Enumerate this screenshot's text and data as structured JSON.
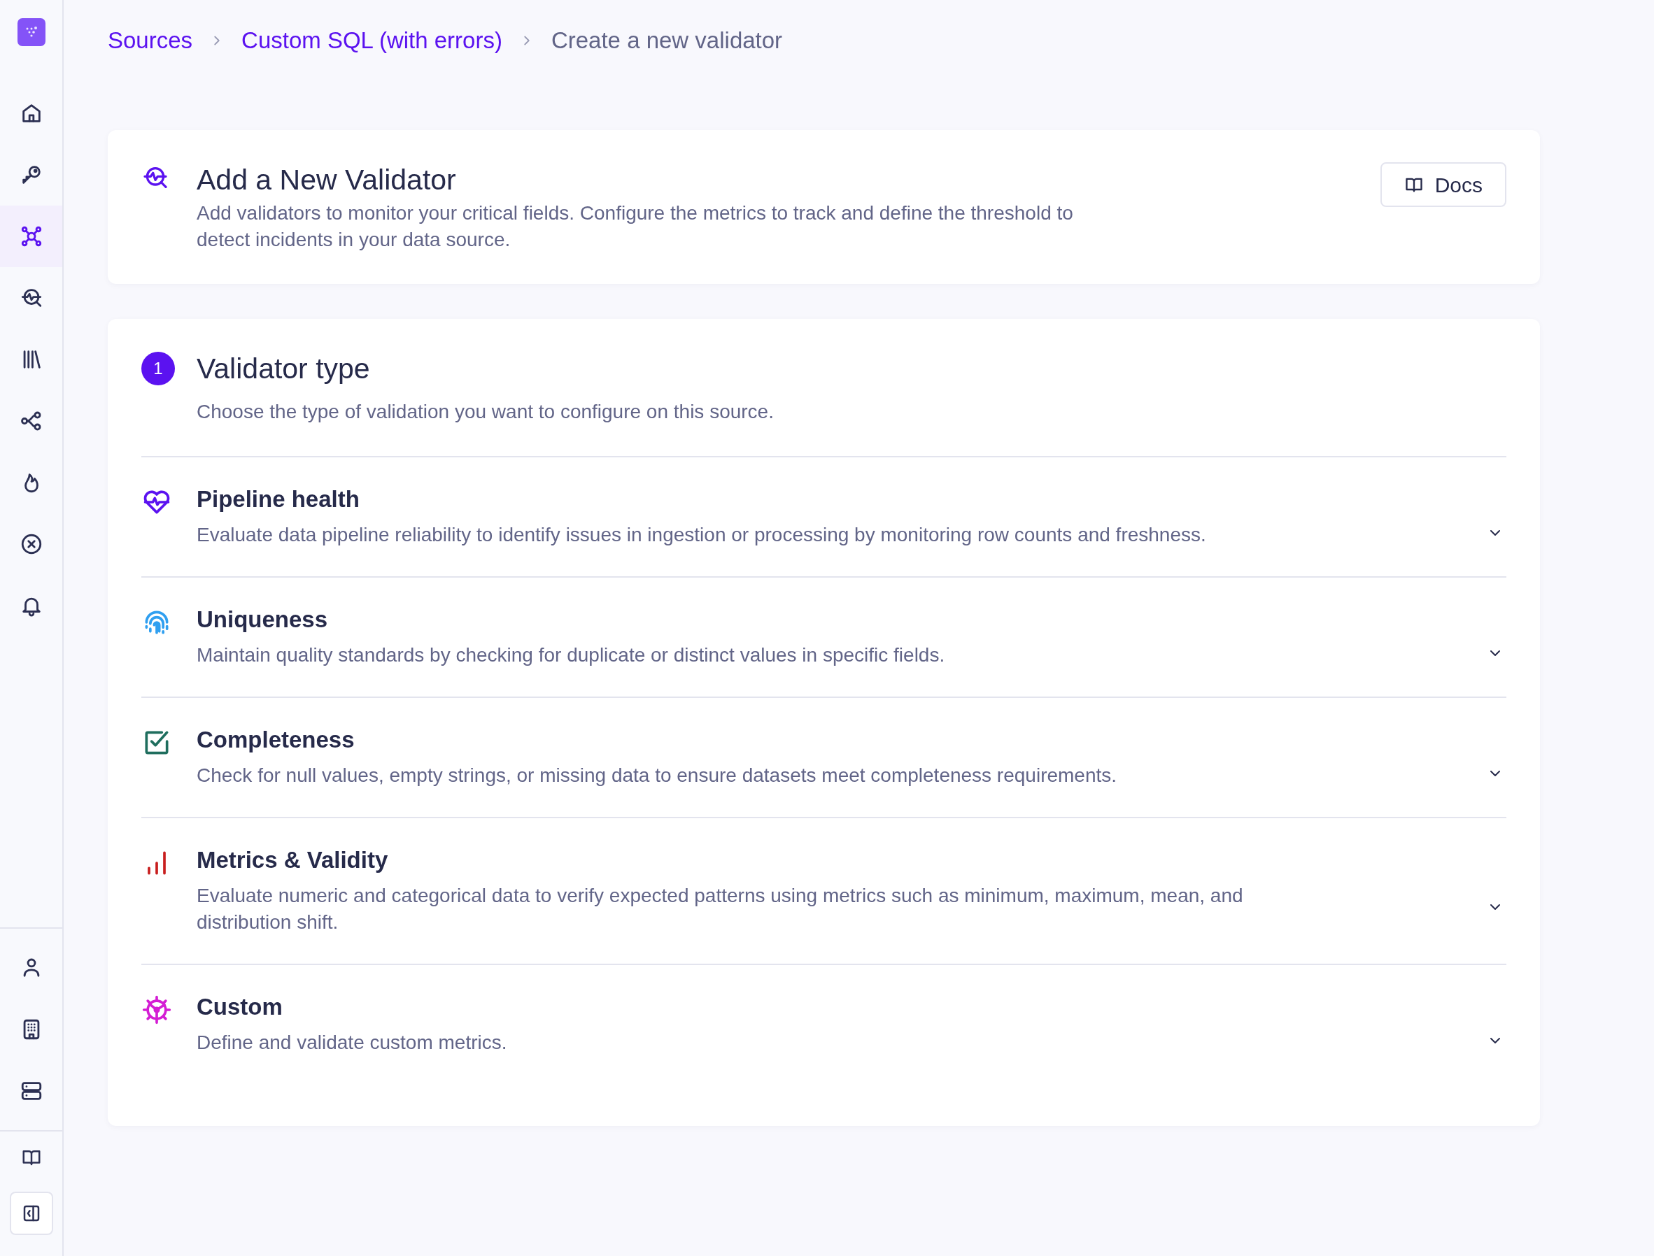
{
  "sidebar": {
    "items": [
      {
        "kind": "home",
        "selected": false
      },
      {
        "kind": "key",
        "selected": false
      },
      {
        "kind": "nodes",
        "selected": true
      },
      {
        "kind": "monitor",
        "selected": false
      },
      {
        "kind": "library",
        "selected": false
      },
      {
        "kind": "share",
        "selected": false
      },
      {
        "kind": "flame",
        "selected": false
      },
      {
        "kind": "cancel",
        "selected": false
      },
      {
        "kind": "bell",
        "selected": false
      }
    ],
    "bottom_items": [
      {
        "kind": "user",
        "selected": false
      },
      {
        "kind": "building",
        "selected": false
      },
      {
        "kind": "server",
        "selected": false
      }
    ],
    "footer_items": [
      {
        "kind": "book"
      },
      {
        "kind": "collapse"
      }
    ]
  },
  "breadcrumb": [
    {
      "label": "Sources",
      "current": false
    },
    {
      "label": "Custom SQL (with errors)",
      "current": false
    },
    {
      "label": "Create a new validator",
      "current": true
    }
  ],
  "header": {
    "title": "Add a New Validator",
    "description": "Add validators to monitor your critical fields. Configure the metrics to track and define the threshold to detect incidents in your data source.",
    "docs_button": "Docs"
  },
  "step": {
    "number": "1",
    "title": "Validator type",
    "description": "Choose the type of validation you want to configure on this source."
  },
  "validator_types": [
    {
      "kind": "pipeline",
      "title": "Pipeline health",
      "description": "Evaluate data pipeline reliability to identify issues in ingestion or processing by monitoring row counts and freshness.",
      "expanded": false
    },
    {
      "kind": "uniqueness",
      "title": "Uniqueness",
      "description": "Maintain quality standards by checking for duplicate or distinct values in specific fields.",
      "expanded": false
    },
    {
      "kind": "completeness",
      "title": "Completeness",
      "description": "Check for null values, empty strings, or missing data to ensure datasets meet completeness requirements.",
      "expanded": false
    },
    {
      "kind": "metrics",
      "title": "Metrics & Validity",
      "description": "Evaluate numeric and categorical data to verify expected patterns using metrics such as minimum, maximum, mean, and distribution shift.",
      "expanded": false
    },
    {
      "kind": "custom",
      "title": "Custom",
      "description": "Define and validate custom metrics.",
      "expanded": false
    }
  ]
}
